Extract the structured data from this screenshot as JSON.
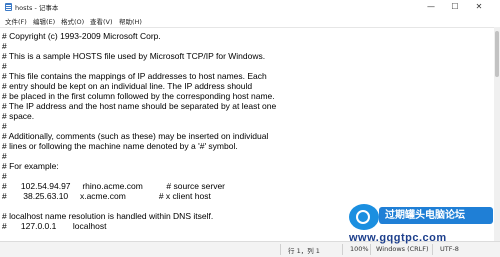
{
  "window": {
    "title": "hosts - 记事本",
    "minimize": "—",
    "maximize": "☐",
    "close": "✕"
  },
  "menu": [
    "文件(F)",
    "编辑(E)",
    "格式(O)",
    "查看(V)",
    "帮助(H)"
  ],
  "lines": [
    "# Copyright (c) 1993-2009 Microsoft Corp.",
    "#",
    "# This is a sample HOSTS file used by Microsoft TCP/IP for Windows.",
    "#",
    "# This file contains the mappings of IP addresses to host names. Each",
    "# entry should be kept on an individual line. The IP address should",
    "# be placed in the first column followed by the corresponding host name.",
    "# The IP address and the host name should be separated by at least one",
    "# space.",
    "#",
    "# Additionally, comments (such as these) may be inserted on individual",
    "# lines or following the machine name denoted by a '#' symbol.",
    "#",
    "# For example:",
    "#",
    "#      102.54.94.97     rhino.acme.com          # source server",
    "#       38.25.63.10     x.acme.com              # x client host",
    "",
    "# localhost name resolution is handled within DNS itself.",
    "#\t127.0.0.1       localhost"
  ],
  "status": {
    "position": "行 1，列 1",
    "zoom": "100%",
    "line_ending": "Windows (CRLF)",
    "encoding": "UTF-8"
  },
  "watermark": {
    "title": "过期罐头电脑论坛",
    "url": "www.gqgtpc.com"
  }
}
